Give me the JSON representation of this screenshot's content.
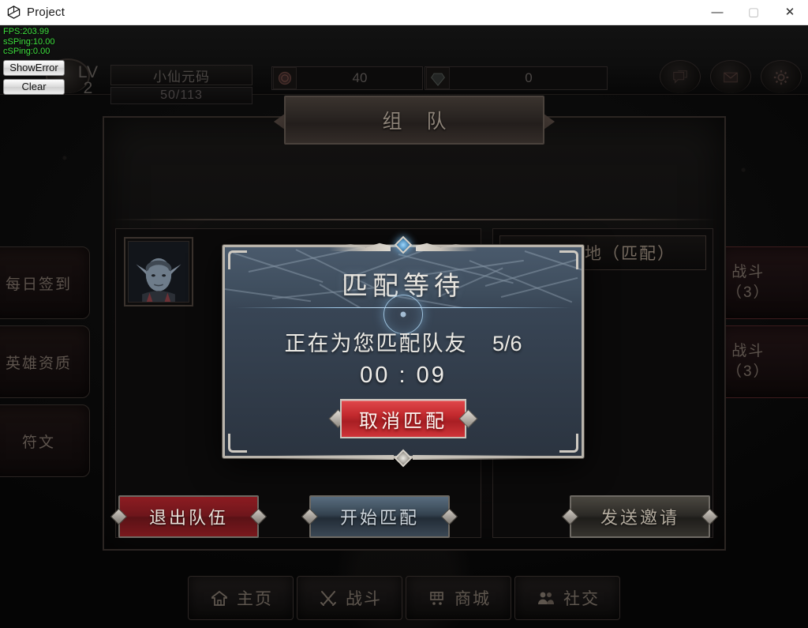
{
  "window": {
    "title": "Project",
    "logo_icon": "unity-logo-icon",
    "controls": {
      "minimize": "—",
      "maximize": "▢",
      "close": "✕"
    }
  },
  "debug_overlay": {
    "lines": [
      "FPS:203.99",
      "sSPing:10.00",
      "cSPing:0.00"
    ],
    "show_error_label": "ShowError",
    "clear_label": "Clear",
    "text_color": "#3ee03e"
  },
  "hud": {
    "avatar_icon": "player-avatar-icon",
    "level_label": "LV",
    "level_value": "2",
    "player_name": "小仙元码",
    "xp_text": "50/113",
    "currencies": [
      {
        "icon": "gold-coin-icon",
        "value": "40"
      },
      {
        "icon": "gem-icon",
        "value": "0"
      }
    ],
    "icons": [
      {
        "name": "chat-icon",
        "glyph": "💬"
      },
      {
        "name": "mail-icon",
        "glyph": "✉"
      },
      {
        "name": "settings-gear-icon",
        "glyph": "⚙"
      }
    ]
  },
  "panel": {
    "title": "组 队",
    "member_portrait_icon": "elf-character-portrait",
    "right_header": "月光营地（匹配）",
    "actions": [
      {
        "label": "退出队伍",
        "style": "red"
      },
      {
        "label": "开始匹配",
        "style": "blue"
      },
      {
        "label": "发送邀请",
        "style": "gray"
      }
    ]
  },
  "rail_left": [
    {
      "label": "每日签到"
    },
    {
      "label": "英雄资质"
    },
    {
      "label": "符文"
    }
  ],
  "rail_right": [
    {
      "line1": "战斗",
      "line2": "（3）"
    },
    {
      "line1": "战斗",
      "line2": "（3）"
    }
  ],
  "bottom_nav": [
    {
      "label": "主页",
      "icon": "home-icon"
    },
    {
      "label": "战斗",
      "icon": "crossed-swords-icon"
    },
    {
      "label": "商城",
      "icon": "shopping-cart-icon"
    },
    {
      "label": "社交",
      "icon": "people-icon"
    }
  ],
  "modal": {
    "title": "匹配等待",
    "status_text": "正在为您匹配队友",
    "count": "5/6",
    "timer": "00 : 09",
    "cancel_label": "取消匹配",
    "spinner_icon": "loading-spinner-icon",
    "gem_icon": "blue-gem-ornament-icon",
    "accent_color": "#c32a2e",
    "panel_color": "#38465a"
  }
}
